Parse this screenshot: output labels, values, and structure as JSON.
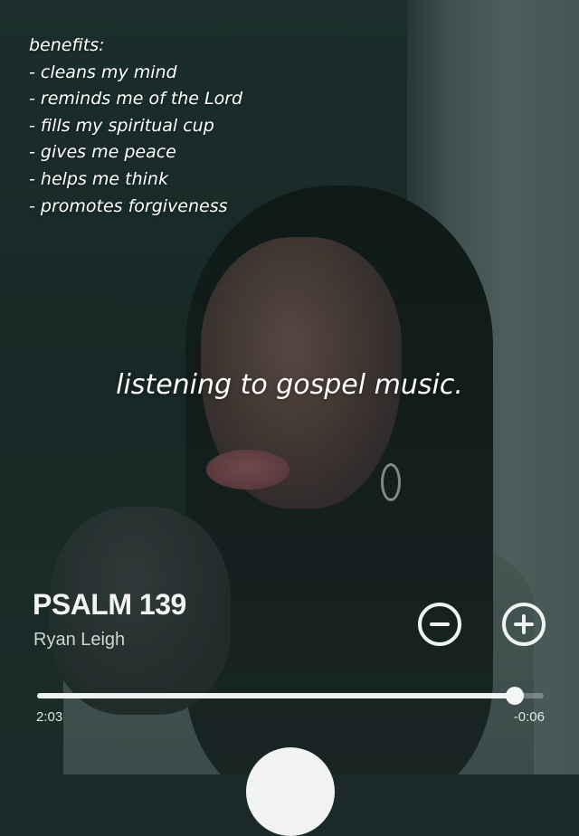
{
  "overlay_text": {
    "heading": "benefits:",
    "items": [
      "- cleans my mind",
      "- reminds me of the Lord",
      "- fills my spiritual cup",
      "- gives me peace",
      "- helps me think",
      "- promotes forgiveness"
    ],
    "caption": "listening to gospel music."
  },
  "player": {
    "title": "PSALM 139",
    "artist": "Ryan Leigh",
    "elapsed": "2:03",
    "remaining": "-0:06",
    "progress_fraction": 0.943,
    "icons": {
      "minus": "minus-circle-icon",
      "plus": "plus-circle-icon",
      "play": "play-button"
    }
  },
  "colors": {
    "control_white": "#eef2f1",
    "track_inactive": "rgba(255,255,255,0.28)",
    "wall_dark": "#1b2a28",
    "wall_light": "#5c6a68"
  }
}
